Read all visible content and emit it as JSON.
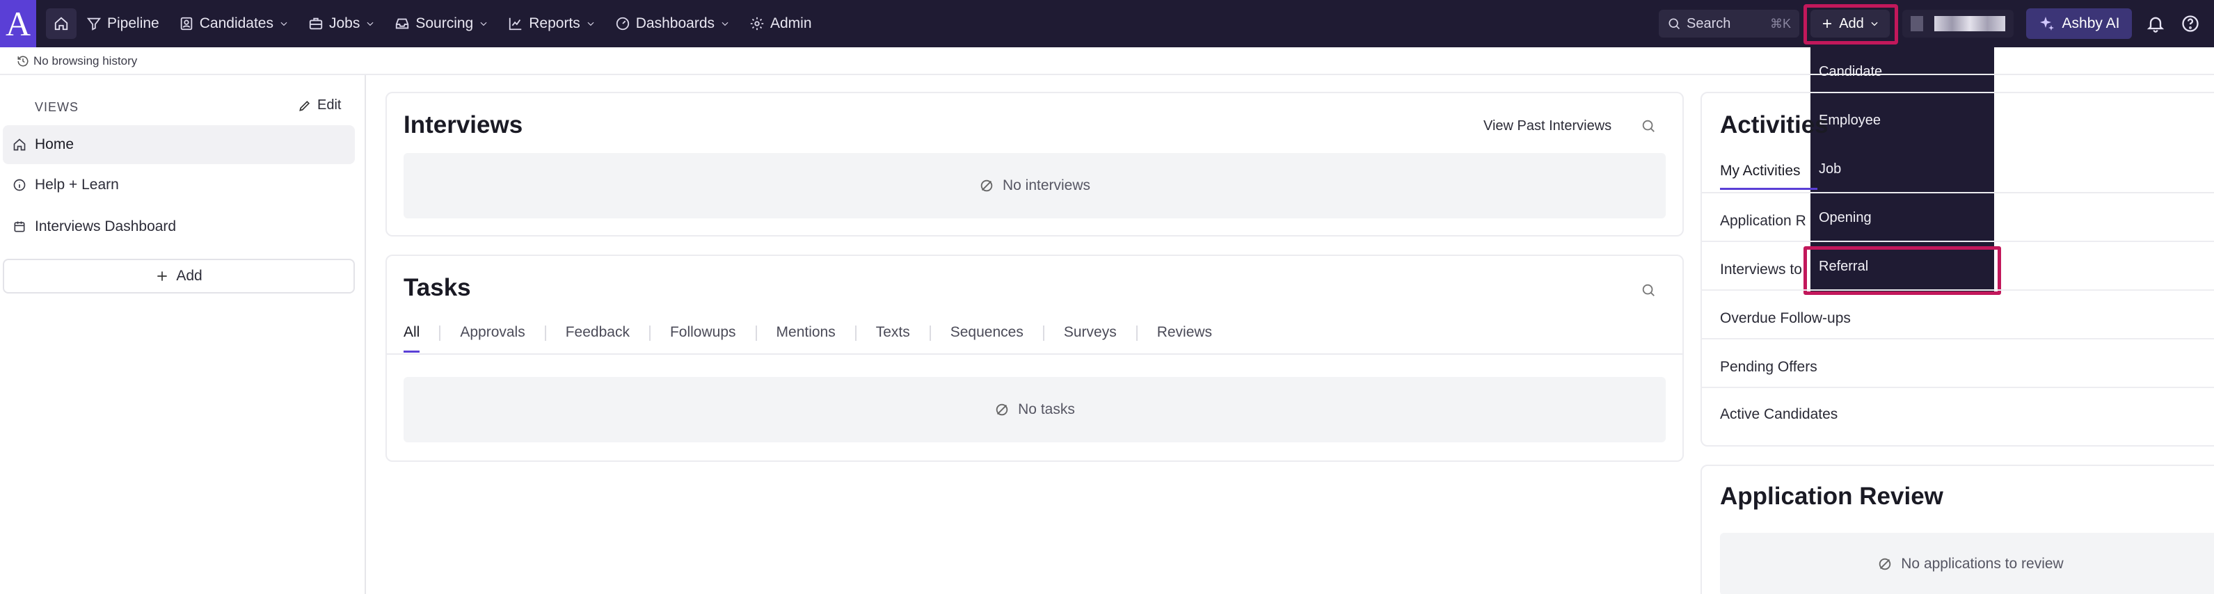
{
  "nav": {
    "logo": "A",
    "items": [
      "Pipeline",
      "Candidates",
      "Jobs",
      "Sourcing",
      "Reports",
      "Dashboards",
      "Admin"
    ],
    "search_label": "Search",
    "search_shortcut": "⌘K",
    "add_label": "Add",
    "ashby_ai_label": "Ashby AI"
  },
  "add_menu": {
    "items": [
      "Candidate",
      "Employee",
      "Job",
      "Opening",
      "Referral"
    ]
  },
  "history": {
    "label": "No browsing history"
  },
  "sidebar": {
    "views_label": "VIEWS",
    "edit_label": "Edit",
    "items": [
      "Home",
      "Help + Learn",
      "Interviews Dashboard"
    ],
    "add_label": "Add"
  },
  "interviews": {
    "title": "Interviews",
    "view_past_label": "View Past Interviews",
    "empty_label": "No interviews"
  },
  "tasks": {
    "title": "Tasks",
    "tabs": [
      "All",
      "Approvals",
      "Feedback",
      "Followups",
      "Mentions",
      "Texts",
      "Sequences",
      "Surveys",
      "Reviews"
    ],
    "empty_label": "No tasks"
  },
  "activities": {
    "title": "Activities",
    "tab": "My Activities",
    "rows": [
      "Application R",
      "Interviews to",
      "Overdue Follow-ups",
      "Pending Offers",
      "Active Candidates"
    ]
  },
  "application_review": {
    "title": "Application Review",
    "empty_label": "No applications to review"
  },
  "colors": {
    "nav_bg": "#1f1b33",
    "brand": "#5a3fd6",
    "highlight": "#c2185b"
  }
}
